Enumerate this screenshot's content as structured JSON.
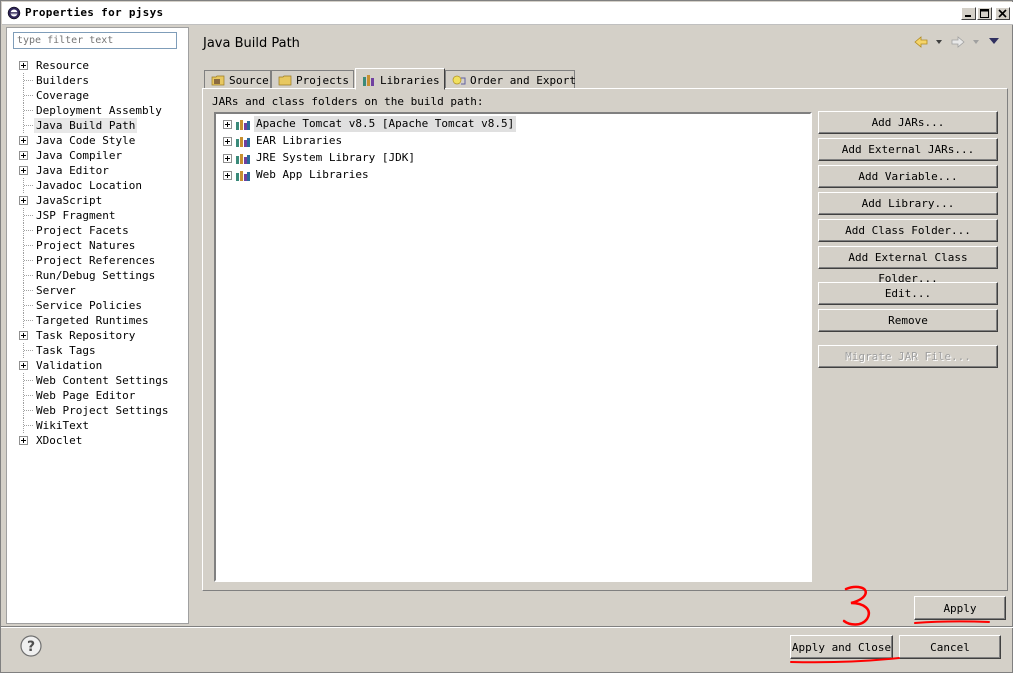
{
  "window": {
    "title": "Properties for pjsys"
  },
  "filter": {
    "placeholder": "type filter text"
  },
  "tree": [
    {
      "label": "Resource",
      "expandable": true
    },
    {
      "label": "Builders",
      "expandable": false
    },
    {
      "label": "Coverage",
      "expandable": false
    },
    {
      "label": "Deployment Assembly",
      "expandable": false
    },
    {
      "label": "Java Build Path",
      "expandable": false,
      "selected": true
    },
    {
      "label": "Java Code Style",
      "expandable": true
    },
    {
      "label": "Java Compiler",
      "expandable": true
    },
    {
      "label": "Java Editor",
      "expandable": true
    },
    {
      "label": "Javadoc Location",
      "expandable": false
    },
    {
      "label": "JavaScript",
      "expandable": true
    },
    {
      "label": "JSP Fragment",
      "expandable": false
    },
    {
      "label": "Project Facets",
      "expandable": false
    },
    {
      "label": "Project Natures",
      "expandable": false
    },
    {
      "label": "Project References",
      "expandable": false
    },
    {
      "label": "Run/Debug Settings",
      "expandable": false
    },
    {
      "label": "Server",
      "expandable": false
    },
    {
      "label": "Service Policies",
      "expandable": false
    },
    {
      "label": "Targeted Runtimes",
      "expandable": false
    },
    {
      "label": "Task Repository",
      "expandable": true
    },
    {
      "label": "Task Tags",
      "expandable": false
    },
    {
      "label": "Validation",
      "expandable": true
    },
    {
      "label": "Web Content Settings",
      "expandable": false
    },
    {
      "label": "Web Page Editor",
      "expandable": false
    },
    {
      "label": "Web Project Settings",
      "expandable": false
    },
    {
      "label": "WikiText",
      "expandable": false
    },
    {
      "label": "XDoclet",
      "expandable": true
    }
  ],
  "page": {
    "title": "Java Build Path"
  },
  "tabs": [
    {
      "label": "Source",
      "icon": "source-folder-icon"
    },
    {
      "label": "Projects",
      "icon": "projects-folder-icon"
    },
    {
      "label": "Libraries",
      "icon": "libraries-icon",
      "active": true
    },
    {
      "label": "Order and Export",
      "icon": "order-export-icon"
    }
  ],
  "libraries": {
    "label": "JARs and class folders on the build path:",
    "items": [
      {
        "label": "Apache Tomcat v8.5 [Apache Tomcat v8.5]",
        "selected": true
      },
      {
        "label": "EAR Libraries"
      },
      {
        "label": "JRE System Library [JDK]"
      },
      {
        "label": "Web App Libraries"
      }
    ]
  },
  "side_buttons": [
    {
      "label": "Add JARs...",
      "enabled": true
    },
    {
      "label": "Add External JARs...",
      "enabled": true
    },
    {
      "label": "Add Variable...",
      "enabled": true
    },
    {
      "label": "Add Library...",
      "enabled": true
    },
    {
      "label": "Add Class Folder...",
      "enabled": true
    },
    {
      "label": "Add External Class Folder...",
      "enabled": true
    },
    {
      "label": "Edit...",
      "enabled": true
    },
    {
      "label": "Remove",
      "enabled": true
    },
    {
      "label": "Migrate JAR File...",
      "enabled": false
    }
  ],
  "footer": {
    "apply": "Apply",
    "apply_close": "Apply and Close",
    "cancel": "Cancel"
  },
  "annotation": {
    "text": "3",
    "color": "#ff0000"
  },
  "colors": {
    "annotation": "#ff0000",
    "dialog_bg": "#d4d0c8"
  }
}
